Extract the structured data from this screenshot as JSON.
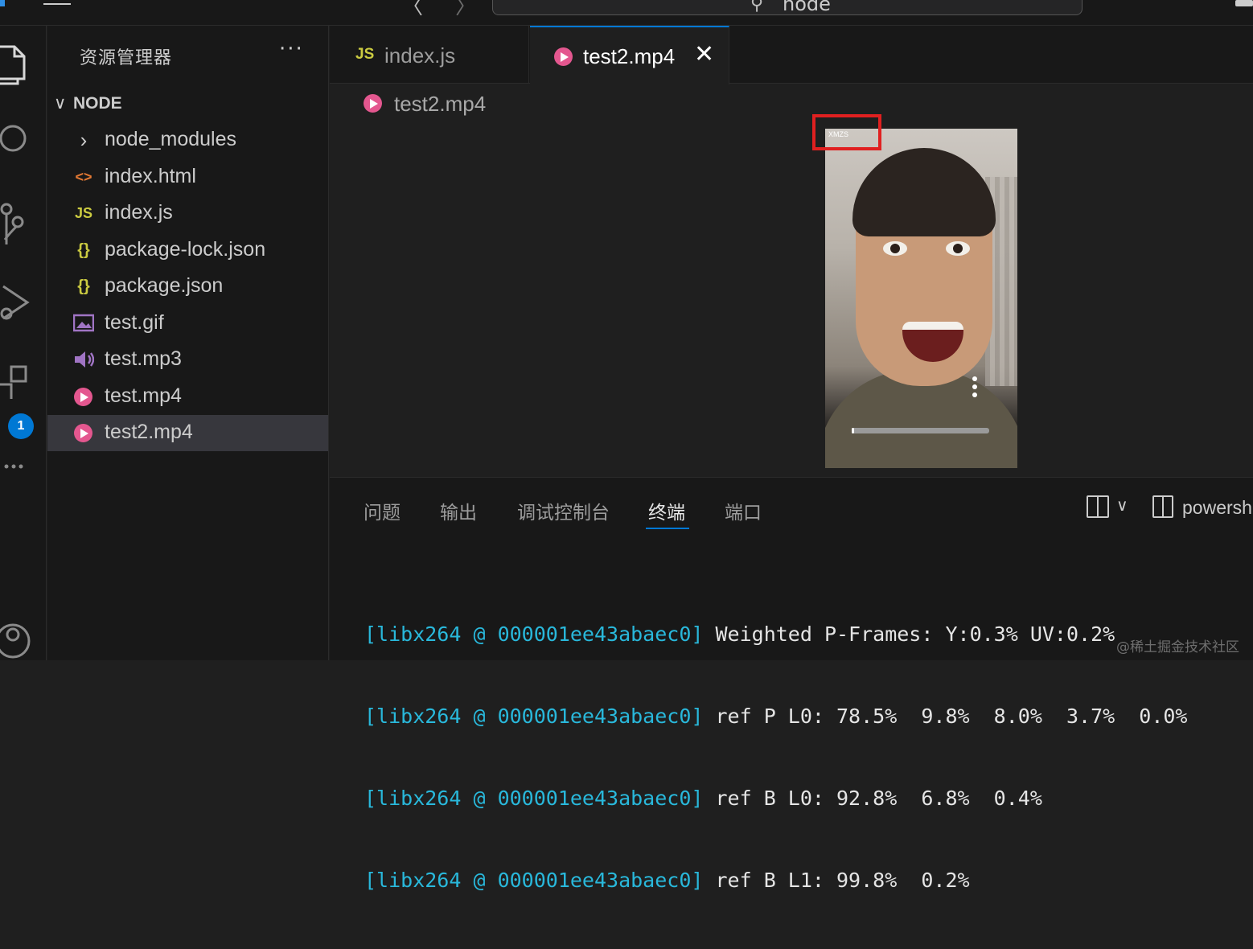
{
  "titlebar": {
    "nav_back": "〈",
    "nav_forward": "〉",
    "search_text": "node"
  },
  "activity_bar": {
    "extensions_badge": "1"
  },
  "sidebar": {
    "title": "资源管理器",
    "more": "···",
    "section": "NODE",
    "section_chevron": "∨",
    "items": [
      {
        "label": "node_modules",
        "icon": "›",
        "icon_color": "#cccccc"
      },
      {
        "label": "index.html",
        "icon": "<>",
        "icon_color": "#e37933"
      },
      {
        "label": "index.js",
        "icon": "JS",
        "icon_color": "#cbcb41"
      },
      {
        "label": "package-lock.json",
        "icon": "{}",
        "icon_color": "#cbcb41"
      },
      {
        "label": "package.json",
        "icon": "{}",
        "icon_color": "#cbcb41"
      },
      {
        "label": "test.gif",
        "icon": "image-icon",
        "icon_color": "#a074c4"
      },
      {
        "label": "test.mp3",
        "icon": "speaker-icon",
        "icon_color": "#a074c4"
      },
      {
        "label": "test.mp4",
        "icon": "play-icon",
        "icon_color": "#e4578f"
      },
      {
        "label": "test2.mp4",
        "icon": "play-icon",
        "icon_color": "#e4578f",
        "selected": true
      }
    ]
  },
  "tabs": [
    {
      "label": "index.js",
      "badge": "JS",
      "active": false
    },
    {
      "label": "test2.mp4",
      "close": "✕",
      "active": true
    }
  ],
  "breadcrumb": {
    "file": "test2.mp4"
  },
  "video": {
    "watermark": "XMZS",
    "progress": 0.01
  },
  "panel": {
    "tabs": [
      "问题",
      "输出",
      "调试控制台",
      "终端",
      "端口"
    ],
    "active_tab": "终端",
    "terminal_name": "powersh",
    "chevron": "∨",
    "lines": [
      {
        "tag": "[libx264 @ 000001ee43abaec0]",
        "msg": " Weighted P-Frames: Y:0.3% UV:0.2%"
      },
      {
        "tag": "[libx264 @ 000001ee43abaec0]",
        "msg": " ref P L0: 78.5%  9.8%  8.0%  3.7%  0.0%"
      },
      {
        "tag": "[libx264 @ 000001ee43abaec0]",
        "msg": " ref B L0: 92.8%  6.8%  0.4%"
      },
      {
        "tag": "[libx264 @ 000001ee43abaec0]",
        "msg": " ref B L1: 99.8%  0.2%"
      }
    ]
  },
  "page_watermark": "@稀土掘金技术社区",
  "colors": {
    "accent": "#0078d4",
    "video_icon": "#e4578f",
    "js_icon": "#cbcb41",
    "terminal_tag": "#29b8db",
    "highlight": "#e02020"
  }
}
